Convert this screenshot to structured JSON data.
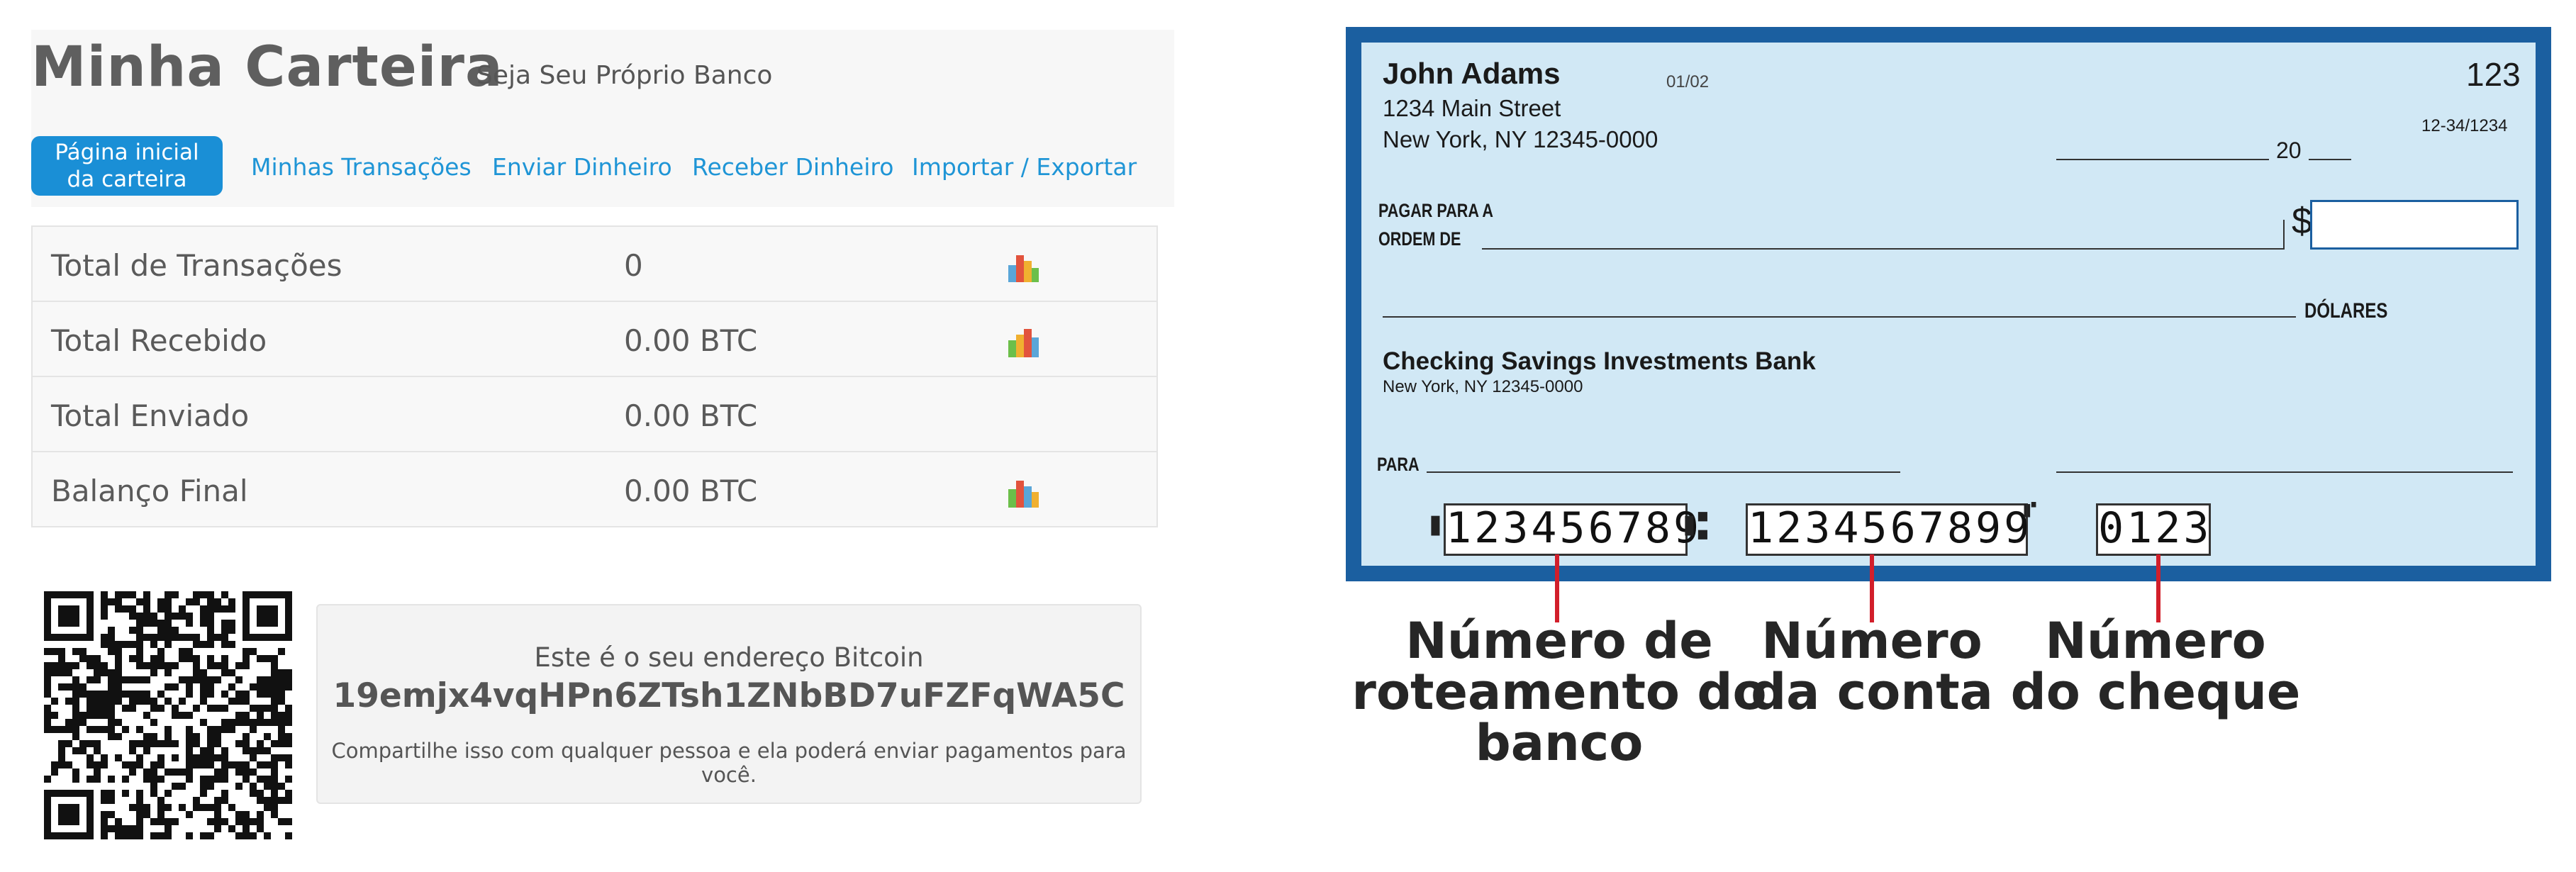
{
  "wallet": {
    "title": "Minha Carteira",
    "subtitle": "Seja Seu Próprio Banco",
    "nav": {
      "home": "Página inicial da carteira",
      "transactions": "Minhas Transações",
      "send": "Enviar Dinheiro",
      "receive": "Receber Dinheiro",
      "import_export": "Importar / Exportar"
    },
    "summary": [
      {
        "label": "Total de Transações",
        "value": "0",
        "chart_icon": true
      },
      {
        "label": "Total Recebido",
        "value": "0.00 BTC",
        "chart_icon": true
      },
      {
        "label": "Total Enviado",
        "value": "0.00 BTC",
        "chart_icon": false
      },
      {
        "label": "Balanço Final",
        "value": "0.00 BTC",
        "chart_icon": true
      }
    ],
    "address": {
      "caption": "Este é o seu endereço Bitcoin",
      "value": "19emjx4vqHPn6ZTsh1ZNbBD7uFZFqWA5C",
      "note": "Compartilhe isso com qualquer pessoa e ela poderá enviar pagamentos para você."
    },
    "accent_color": "#1a8fd6"
  },
  "cheque": {
    "holder_name": "John Adams",
    "holder_street": "1234 Main Street",
    "holder_city": "New York, NY 12345-0000",
    "date_code": "01/02",
    "check_number": "123",
    "fraction_code": "12-34/1234",
    "date_prefix": "20",
    "pay_to_line1": "PAGAR PARA A",
    "pay_to_line2": "ORDEM DE",
    "currency_symbol": "$",
    "dollars_label": "DÓLARES",
    "bank_name": "Checking Savings Investments Bank",
    "bank_city": "New York, NY 12345-0000",
    "memo_label": "PARA",
    "routing_number": "123456789",
    "account_number": "1234567899",
    "check_serial": "0123",
    "border_color": "#1b5fa0",
    "paper_color": "#d1e8f5"
  },
  "callouts": {
    "routing": [
      "Número de",
      "roteamento do",
      "banco"
    ],
    "account": [
      "Número",
      "da conta"
    ],
    "check": [
      "Número",
      "do cheque"
    ],
    "line_color": "#d21f2b"
  }
}
